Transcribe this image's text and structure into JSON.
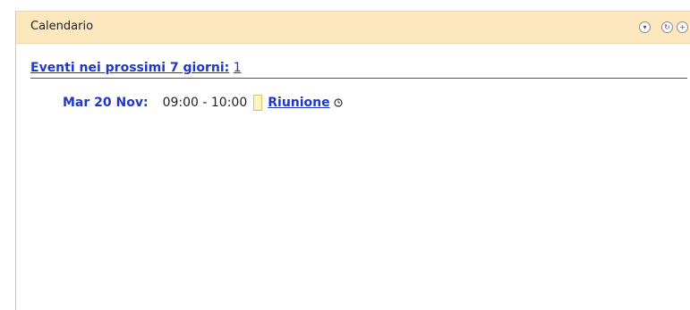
{
  "widget": {
    "title": "Calendario",
    "icons": {
      "minimize": "minimize-icon",
      "refresh": "refresh-icon",
      "expand": "plus-icon"
    }
  },
  "summary": {
    "label": "Eventi nei prossimi 7 giorni:",
    "count": "1"
  },
  "events": [
    {
      "date": "Mar 20 Nov:",
      "time": "09:00 - 10:00",
      "title": "Riunione",
      "swatch_color": "#fff4bf",
      "reminder_icon": "clock-icon"
    }
  ],
  "colors": {
    "header_bg": "#fde7bf",
    "link": "#1f38c8"
  }
}
